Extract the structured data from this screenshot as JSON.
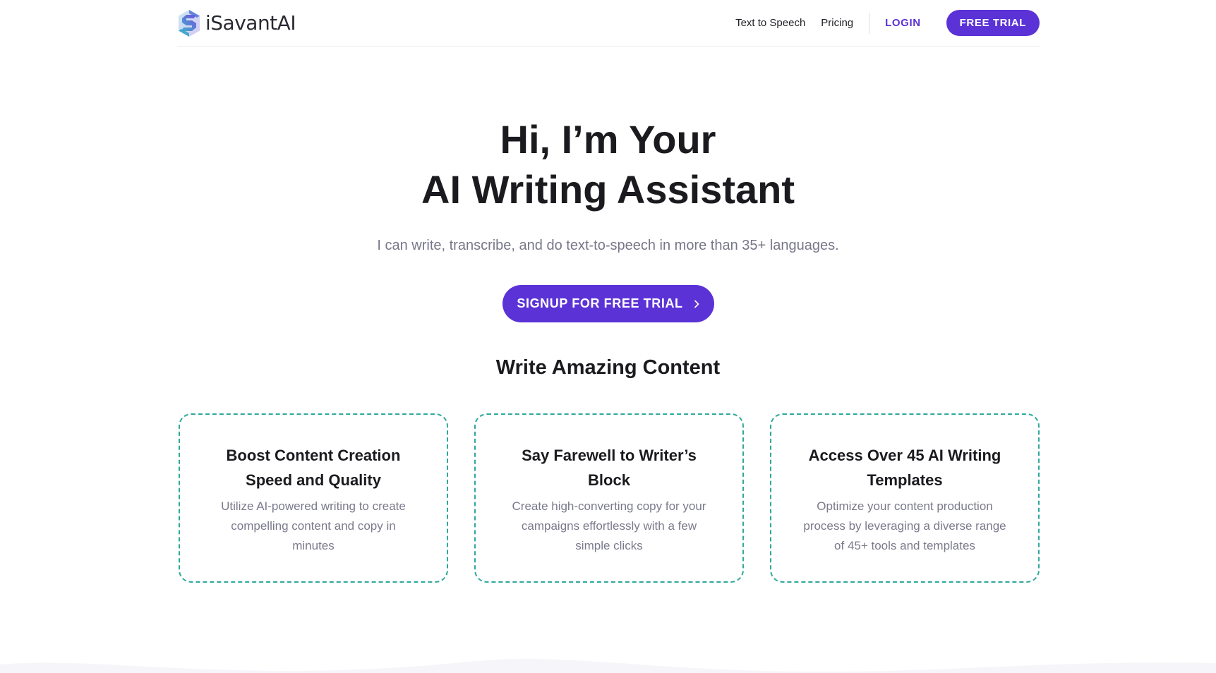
{
  "header": {
    "brand_name": "iSavantAI",
    "nav": {
      "text_to_speech": "Text to Speech",
      "pricing": "Pricing",
      "login": "LOGIN",
      "free_trial": "FREE TRIAL"
    }
  },
  "hero": {
    "title_line1": "Hi, I’m Your",
    "title_line2": "AI Writing Assistant",
    "subtitle": "I can write, transcribe, and do text-to-speech in more than 35+ languages.",
    "cta_label": "SIGNUP FOR FREE TRIAL"
  },
  "features": {
    "section_title": "Write Amazing Content",
    "cards": [
      {
        "title_line1": "Boost Content Creation",
        "title_line2": "Speed and Quality",
        "desc_line1": "Utilize AI-powered writing to create",
        "desc_line2": "compelling content and copy in",
        "desc_line3": "minutes"
      },
      {
        "title_line1": "Say Farewell to Writer’s",
        "title_line2": "Block",
        "desc_line1": "Create high-converting copy for your",
        "desc_line2": "campaigns effortlessly with a few",
        "desc_line3": "simple clicks"
      },
      {
        "title_line1": "Access Over 45 AI Writing",
        "title_line2": "Templates",
        "desc_line1": "Optimize your content production",
        "desc_line2": "process by leveraging a diverse range",
        "desc_line3": "of 45+ tools and templates"
      }
    ]
  },
  "colors": {
    "accent": "#5b32d6",
    "card_border": "#2fa89d",
    "heading": "#1b1b1f",
    "muted_text": "#777789"
  },
  "icons": {
    "brand": "isavantai-logo-icon",
    "cta": "chevron-right-icon"
  }
}
